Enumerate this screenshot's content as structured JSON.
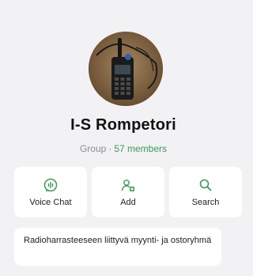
{
  "group": {
    "name": "I-S Rompetori",
    "type_label": "Group",
    "separator": "·",
    "members_label": "57 members",
    "description": "Radioharrasteeseen liittyvä myynti- ja ostoryhmä"
  },
  "actions": [
    {
      "label": "Voice Chat",
      "icon": "voice-chat-icon"
    },
    {
      "label": "Add",
      "icon": "add-member-icon"
    },
    {
      "label": "Search",
      "icon": "search-icon"
    }
  ],
  "colors": {
    "accent": "#3a9a57",
    "background": "#f2f2f4",
    "card": "#ffffff"
  }
}
